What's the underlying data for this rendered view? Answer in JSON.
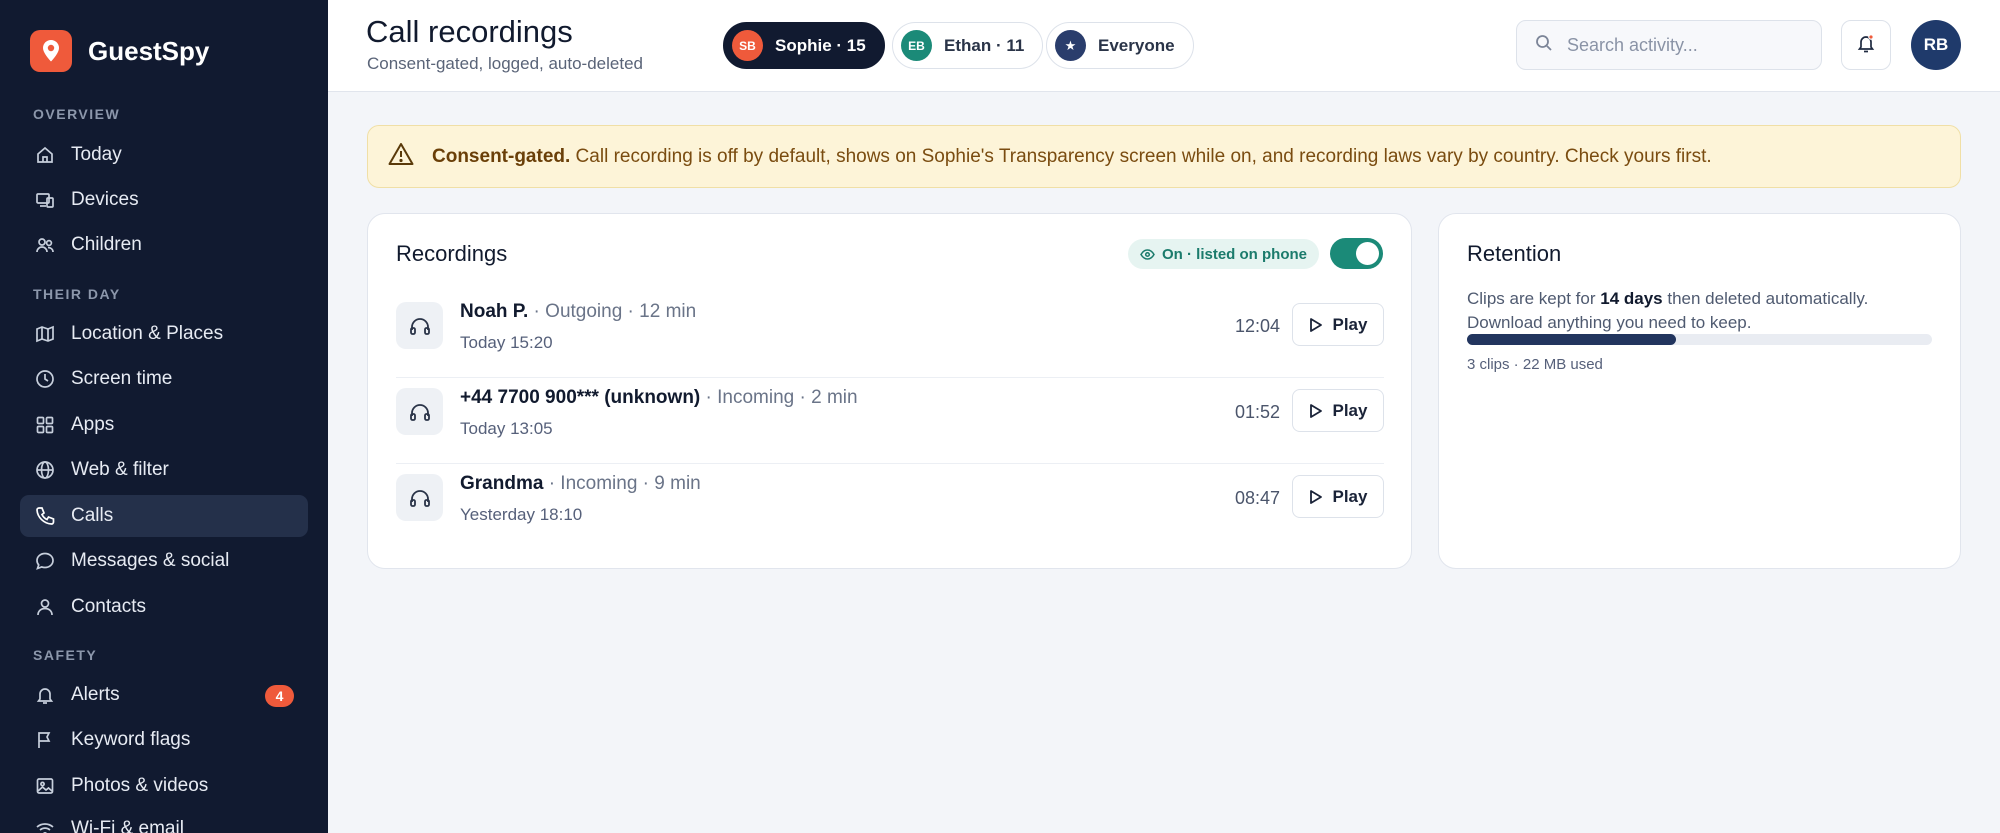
{
  "app": {
    "name": "GuestSpy",
    "accent": "#ef5a3b"
  },
  "sidebar": {
    "sections": [
      "OVERVIEW",
      "THEIR DAY",
      "SAFETY"
    ],
    "items": [
      {
        "label": "Today",
        "icon": "home-icon"
      },
      {
        "label": "Devices",
        "icon": "devices-icon"
      },
      {
        "label": "Children",
        "icon": "users-icon"
      },
      {
        "label": "Location & Places",
        "icon": "map-icon"
      },
      {
        "label": "Screen time",
        "icon": "clock-icon"
      },
      {
        "label": "Apps",
        "icon": "grid-icon"
      },
      {
        "label": "Web & filter",
        "icon": "globe-icon"
      },
      {
        "label": "Calls",
        "icon": "phone-icon",
        "active": true
      },
      {
        "label": "Messages & social",
        "icon": "message-icon"
      },
      {
        "label": "Contacts",
        "icon": "user-icon"
      },
      {
        "label": "Alerts",
        "icon": "bell-icon",
        "badge": "4"
      },
      {
        "label": "Keyword flags",
        "icon": "flag-icon"
      },
      {
        "label": "Photos & videos",
        "icon": "image-icon"
      },
      {
        "label": "Wi-Fi & email",
        "icon": "wifi-icon"
      }
    ]
  },
  "header": {
    "title": "Call recordings",
    "subtitle": "Consent-gated, logged, auto-deleted",
    "profiles": [
      {
        "initials": "SB",
        "label": "Sophie · 15",
        "color": "#ef5a3b",
        "active": true
      },
      {
        "initials": "EB",
        "label": "Ethan · 11",
        "color": "#1b8a78"
      },
      {
        "initials": "★",
        "label": "Everyone",
        "color": "#2a3d6c"
      }
    ],
    "search_placeholder": "Search activity...",
    "user_initials": "RB"
  },
  "banner": {
    "strong": "Consent-gated.",
    "text": " Call recording is off by default, shows on Sophie's Transparency screen while on, and recording laws vary by country. Check yours first."
  },
  "recordings": {
    "title": "Recordings",
    "status": "On · listed on phone",
    "enabled": true,
    "play_label": "Play",
    "items": [
      {
        "name": "Noah P.",
        "meta": " · Outgoing · 12 min",
        "when": "Today 15:20",
        "duration": "12:04"
      },
      {
        "name": "+44 7700 900*** (unknown)",
        "meta": " · Incoming · 2 min",
        "when": "Today 13:05",
        "duration": "01:52"
      },
      {
        "name": "Grandma",
        "meta": " · Incoming · 9 min",
        "when": "Yesterday 18:10",
        "duration": "08:47"
      }
    ]
  },
  "retention": {
    "title": "Retention",
    "text_before": "Clips are kept for ",
    "days": "14 days",
    "text_after": " then deleted automatically. Download anything you need to keep.",
    "usage_fraction": 0.45,
    "footer": "3 clips · 22 MB used"
  }
}
